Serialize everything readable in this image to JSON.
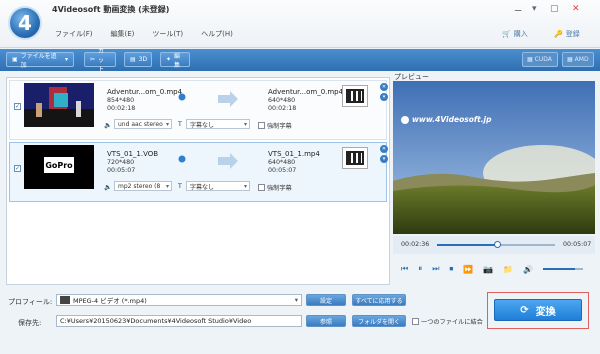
{
  "app": {
    "logo_text": "4",
    "title": "4Videosoft 動画変換 (未登録)"
  },
  "menu": [
    "ファイル(F)",
    "編集(E)",
    "ツール(T)",
    "ヘルプ(H)"
  ],
  "header_buttons": {
    "purchase": "購入",
    "register": "登録"
  },
  "toolbar": {
    "add_file": "ファイルを追加",
    "cut": "カット",
    "threeD": "3D",
    "edit": "編集",
    "cuda": "CUDA",
    "amd": "AMD"
  },
  "files": [
    {
      "source_name": "Adventur...om_0.mp4",
      "source_res": "854*480",
      "source_dur": "00:02:18",
      "output_name": "Adventur...om_0.mp4",
      "output_res": "640*480",
      "output_dur": "00:02:18",
      "audio": "und aac stereo",
      "subtitle": "字幕なし",
      "forced_sub": "強制字幕",
      "thumb_caption": ""
    },
    {
      "source_name": "VTS_01_1.VOB",
      "source_res": "720*480",
      "source_dur": "00:05:07",
      "output_name": "VTS_01_1.mp4",
      "output_res": "640*480",
      "output_dur": "00:05:07",
      "audio": "mp2 stereo (8",
      "subtitle": "字幕なし",
      "forced_sub": "強制字幕",
      "thumb_caption": "GoPro"
    }
  ],
  "preview": {
    "label": "プレビュー",
    "watermark": "www.4Videosoft.jp",
    "time_current": "00:02:36",
    "time_total": "00:05:07",
    "progress": 0.51,
    "volume": 0.8
  },
  "bottom": {
    "profile_label": "プロフィール:",
    "profile_value": "MPEG-4 ビデオ (*.mp4)",
    "settings_btn": "設定",
    "apply_all_btn": "すべてに応用する",
    "dest_label": "保存先:",
    "dest_value": "C:¥Users¥20150623¥Documents¥4Videosoft Studio¥Video",
    "browse_btn": "参照",
    "open_folder_btn": "フォルダを開く",
    "merge_label": "一つのファイルに結合",
    "convert_btn": "変換"
  }
}
